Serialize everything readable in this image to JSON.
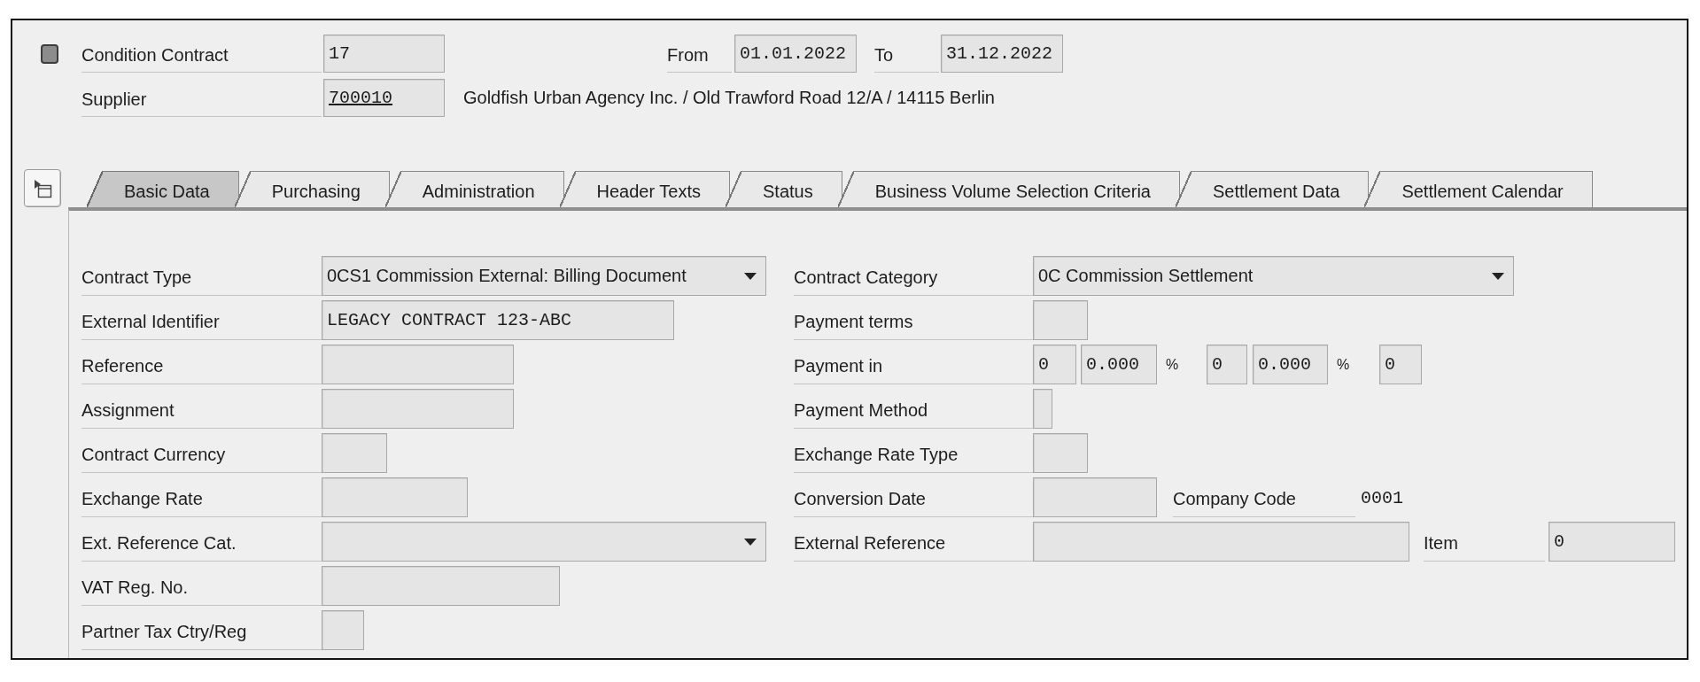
{
  "header": {
    "condition_contract": {
      "label": "Condition Contract",
      "value": "17"
    },
    "validity": {
      "from_label": "From",
      "from": "01.01.2022",
      "to_label": "To",
      "to": "31.12.2022"
    },
    "supplier": {
      "label": "Supplier",
      "value": "700010",
      "description": "Goldfish Urban Agency Inc. / Old Trawford Road 12/A / 14115 Berlin"
    }
  },
  "tabs": [
    {
      "label": "Basic Data",
      "selected": true
    },
    {
      "label": "Purchasing",
      "selected": false
    },
    {
      "label": "Administration",
      "selected": false
    },
    {
      "label": "Header Texts",
      "selected": false
    },
    {
      "label": "Status",
      "selected": false
    },
    {
      "label": "Business Volume Selection Criteria",
      "selected": false
    },
    {
      "label": "Settlement Data",
      "selected": false
    },
    {
      "label": "Settlement Calendar",
      "selected": false
    }
  ],
  "basic_data": {
    "left": [
      {
        "label": "Contract Type",
        "fields": [
          {
            "kind": "dropdown",
            "value": "0CS1 Commission External: Billing Document"
          }
        ]
      },
      {
        "label": "External Identifier",
        "fields": [
          {
            "kind": "input",
            "value": "LEGACY CONTRACT 123-ABC"
          }
        ]
      },
      {
        "label": "Reference",
        "fields": [
          {
            "kind": "input"
          }
        ]
      },
      {
        "label": "Assignment",
        "fields": [
          {
            "kind": "input"
          }
        ]
      },
      {
        "label": "Contract Currency",
        "fields": [
          {
            "kind": "input"
          }
        ]
      },
      {
        "label": "Exchange Rate",
        "fields": [
          {
            "kind": "input"
          }
        ]
      },
      {
        "label": "Ext. Reference Cat.",
        "fields": [
          {
            "kind": "dropdown"
          }
        ]
      },
      {
        "label": "VAT Reg. No.",
        "fields": [
          {
            "kind": "input"
          }
        ]
      },
      {
        "label": "Partner Tax Ctry/Reg",
        "fields": [
          {
            "kind": "input"
          }
        ]
      }
    ],
    "right": [
      {
        "label": "Contract Category",
        "fields": [
          {
            "kind": "dropdown",
            "value": "0C Commission Settlement"
          }
        ]
      },
      {
        "label": "Payment terms",
        "fields": [
          {
            "kind": "input"
          }
        ]
      },
      {
        "label": "Payment in",
        "fields": [
          {
            "kind": "input",
            "value": "0"
          },
          {
            "kind": "input",
            "value": "0.000"
          },
          {
            "kind": "unit",
            "text": "%"
          },
          {
            "kind": "input",
            "value": "0"
          },
          {
            "kind": "input",
            "value": "0.000"
          },
          {
            "kind": "unit",
            "text": "%"
          },
          {
            "kind": "input",
            "value": "0"
          }
        ]
      },
      {
        "label": "Payment Method",
        "fields": [
          {
            "kind": "input"
          }
        ]
      },
      {
        "label": "Exchange Rate Type",
        "fields": [
          {
            "kind": "input"
          }
        ]
      },
      {
        "label": "Conversion Date",
        "fields": [
          {
            "kind": "input"
          },
          {
            "kind": "label",
            "text": "Company Code"
          },
          {
            "kind": "text",
            "text": "0001"
          }
        ]
      },
      {
        "label": "External Reference",
        "fields": [
          {
            "kind": "input"
          },
          {
            "kind": "label",
            "text": "Item"
          },
          {
            "kind": "input",
            "value": "0"
          }
        ]
      }
    ]
  }
}
